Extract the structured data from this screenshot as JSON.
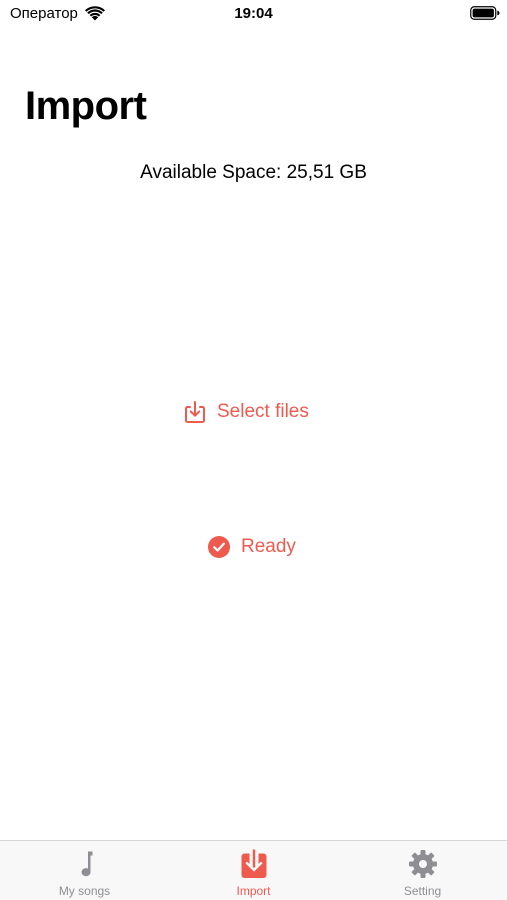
{
  "status_bar": {
    "carrier": "Оператор",
    "time": "19:04",
    "wifi_icon": "wifi-icon",
    "battery_icon": "battery-icon"
  },
  "page": {
    "title": "Import",
    "available_space": "Available Space: 25,51 GB"
  },
  "actions": {
    "select_files_label": "Select files",
    "select_files_icon": "download-tray-icon"
  },
  "status": {
    "ready_label": "Ready",
    "ready_icon": "checkmark-circle-icon"
  },
  "tab_bar": {
    "items": [
      {
        "label": "My songs",
        "icon": "music-note-icon",
        "active": false
      },
      {
        "label": "Import",
        "icon": "import-icon",
        "active": true
      },
      {
        "label": "Setting",
        "icon": "gear-icon",
        "active": false
      }
    ]
  },
  "colors": {
    "accent": "#ef5a4f",
    "inactive": "#8e8e93",
    "text": "#000000",
    "tab_bar_bg": "#f8f8f8"
  }
}
